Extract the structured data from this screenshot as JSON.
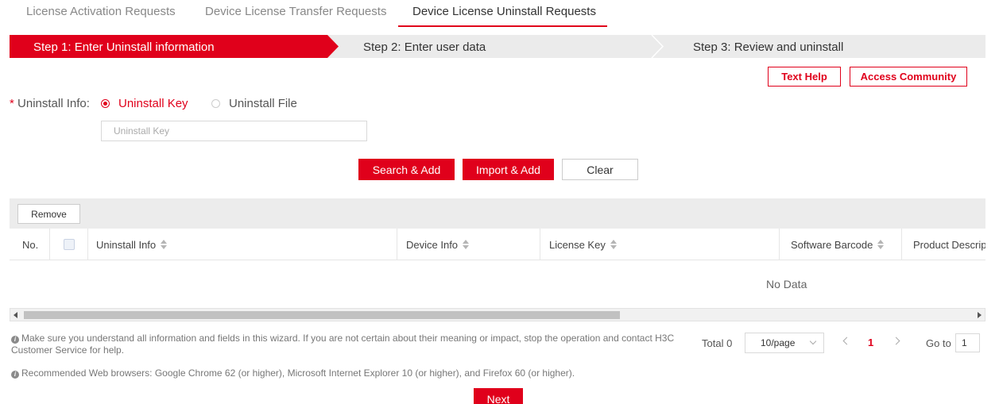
{
  "tabs": [
    {
      "label": "License Activation Requests",
      "active": false
    },
    {
      "label": "Device License Transfer Requests",
      "active": false
    },
    {
      "label": "Device License Uninstall Requests",
      "active": true
    }
  ],
  "steps": [
    {
      "label": "Step 1: Enter Uninstall information",
      "active": true
    },
    {
      "label": "Step 2: Enter user data",
      "active": false
    },
    {
      "label": "Step 3: Review and uninstall",
      "active": false
    }
  ],
  "help_buttons": {
    "text_help": "Text Help",
    "access_community": "Access Community"
  },
  "uninstall_info": {
    "required_mark": "*",
    "label": "Uninstall Info:",
    "options": [
      {
        "label": "Uninstall Key",
        "selected": true
      },
      {
        "label": "Uninstall File",
        "selected": false
      }
    ],
    "key_input": {
      "value": "",
      "placeholder": "Uninstall Key"
    }
  },
  "actions": {
    "search_add": "Search & Add",
    "import_add": "Import & Add",
    "clear": "Clear"
  },
  "table": {
    "remove_label": "Remove",
    "columns": [
      "No.",
      "Uninstall Info",
      "Device Info",
      "License Key",
      "Software Barcode",
      "Product Descrip"
    ],
    "empty_text": "No Data"
  },
  "notes": {
    "warning": "Make sure you understand all information and fields in this wizard. If you are not certain about their meaning or impact, stop the operation and contact H3C Customer Service for help.",
    "browsers": "Recommended Web browsers: Google Chrome 62 (or higher), Microsoft Internet Explorer 10 (or higher), and Firefox 60 (or higher)."
  },
  "pagination": {
    "total_label": "Total 0",
    "page_size": "10/page",
    "current_page": "1",
    "goto_label": "Go to",
    "goto_value": "1"
  },
  "next_label": "Next",
  "colors": {
    "accent": "#e0001b",
    "step_inactive_bg": "#ebebeb"
  }
}
